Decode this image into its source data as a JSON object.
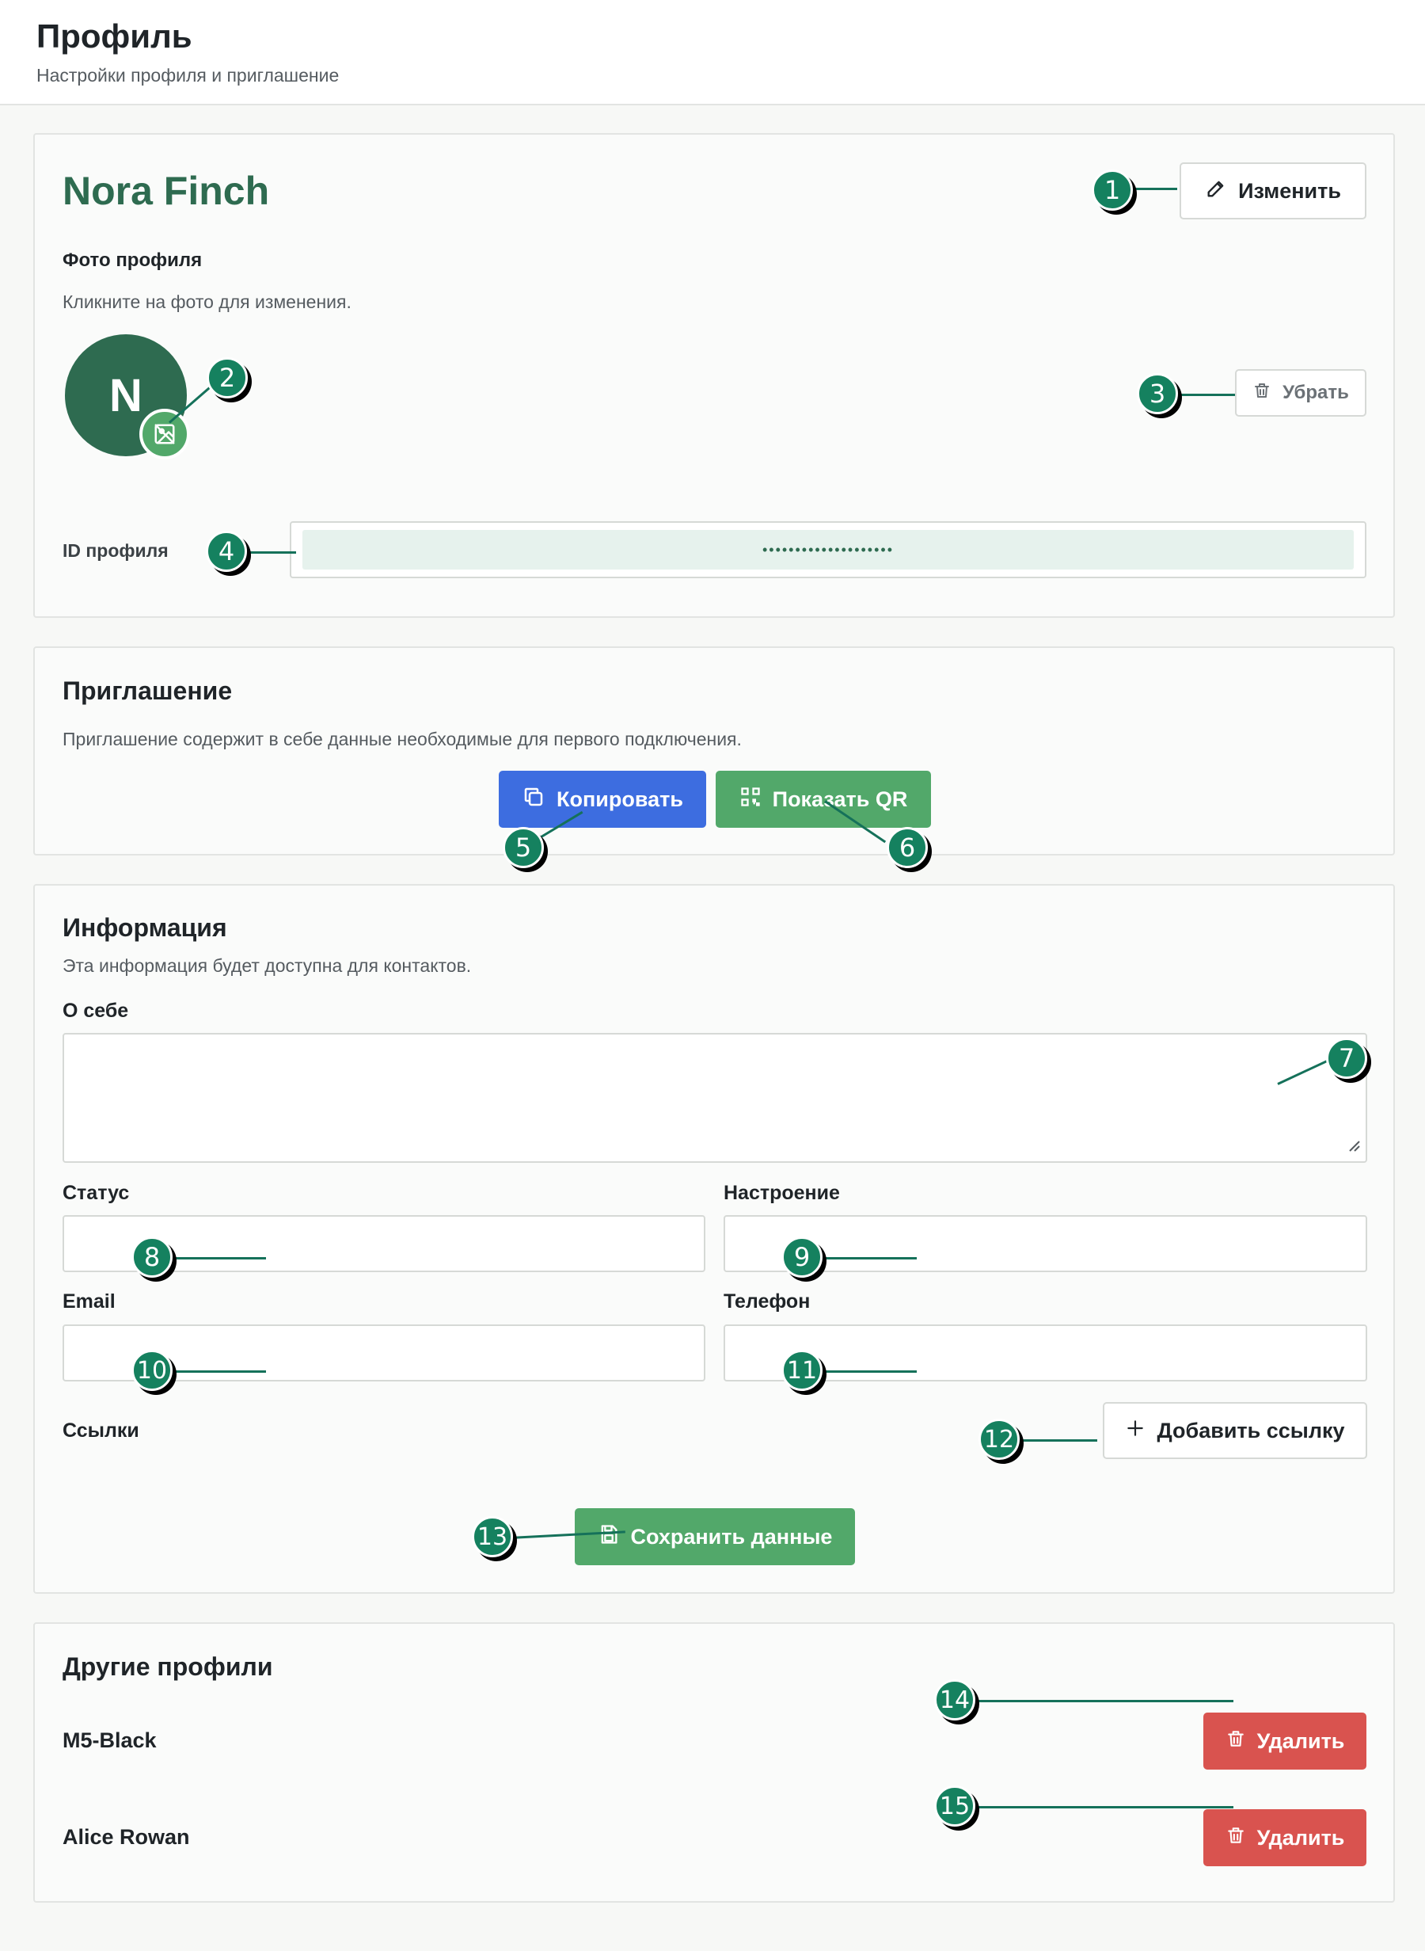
{
  "header": {
    "title": "Профиль",
    "subtitle": "Настройки профиля и приглашение"
  },
  "profile": {
    "name": "Nora Finch",
    "edit_label": "Изменить",
    "photo_title": "Фото профиля",
    "photo_hint": "Кликните на фото для изменения.",
    "avatar_initial": "N",
    "remove_label": "Убрать",
    "id_label": "ID профиля",
    "id_value": "••••••••••••••••••••"
  },
  "invite": {
    "title": "Приглашение",
    "description": "Приглашение содержит в себе данные необходимые для первого подключения.",
    "copy_label": "Копировать",
    "qr_label": "Показать QR"
  },
  "info": {
    "title": "Информация",
    "description": "Эта информация будет доступна для контактов.",
    "about_label": "О себе",
    "about_value": "",
    "status_label": "Статус",
    "status_value": "",
    "mood_label": "Настроение",
    "mood_value": "",
    "email_label": "Email",
    "email_value": "",
    "phone_label": "Телефон",
    "phone_value": "",
    "links_label": "Ссылки",
    "add_link_label": "Добавить ссылку",
    "save_label": "Сохранить данные"
  },
  "other_profiles": {
    "title": "Другие профили",
    "items": [
      {
        "name": "M5-Black",
        "delete_label": "Удалить"
      },
      {
        "name": "Alice Rowan",
        "delete_label": "Удалить"
      }
    ]
  },
  "markers": [
    "1",
    "2",
    "3",
    "4",
    "5",
    "6",
    "7",
    "8",
    "9",
    "10",
    "11",
    "12",
    "13",
    "14",
    "15"
  ],
  "colors": {
    "brand_green": "#2e6b50",
    "accent_green": "#52a86a",
    "blue": "#3d6de0",
    "red": "#d9534f",
    "marker": "#15815f"
  }
}
